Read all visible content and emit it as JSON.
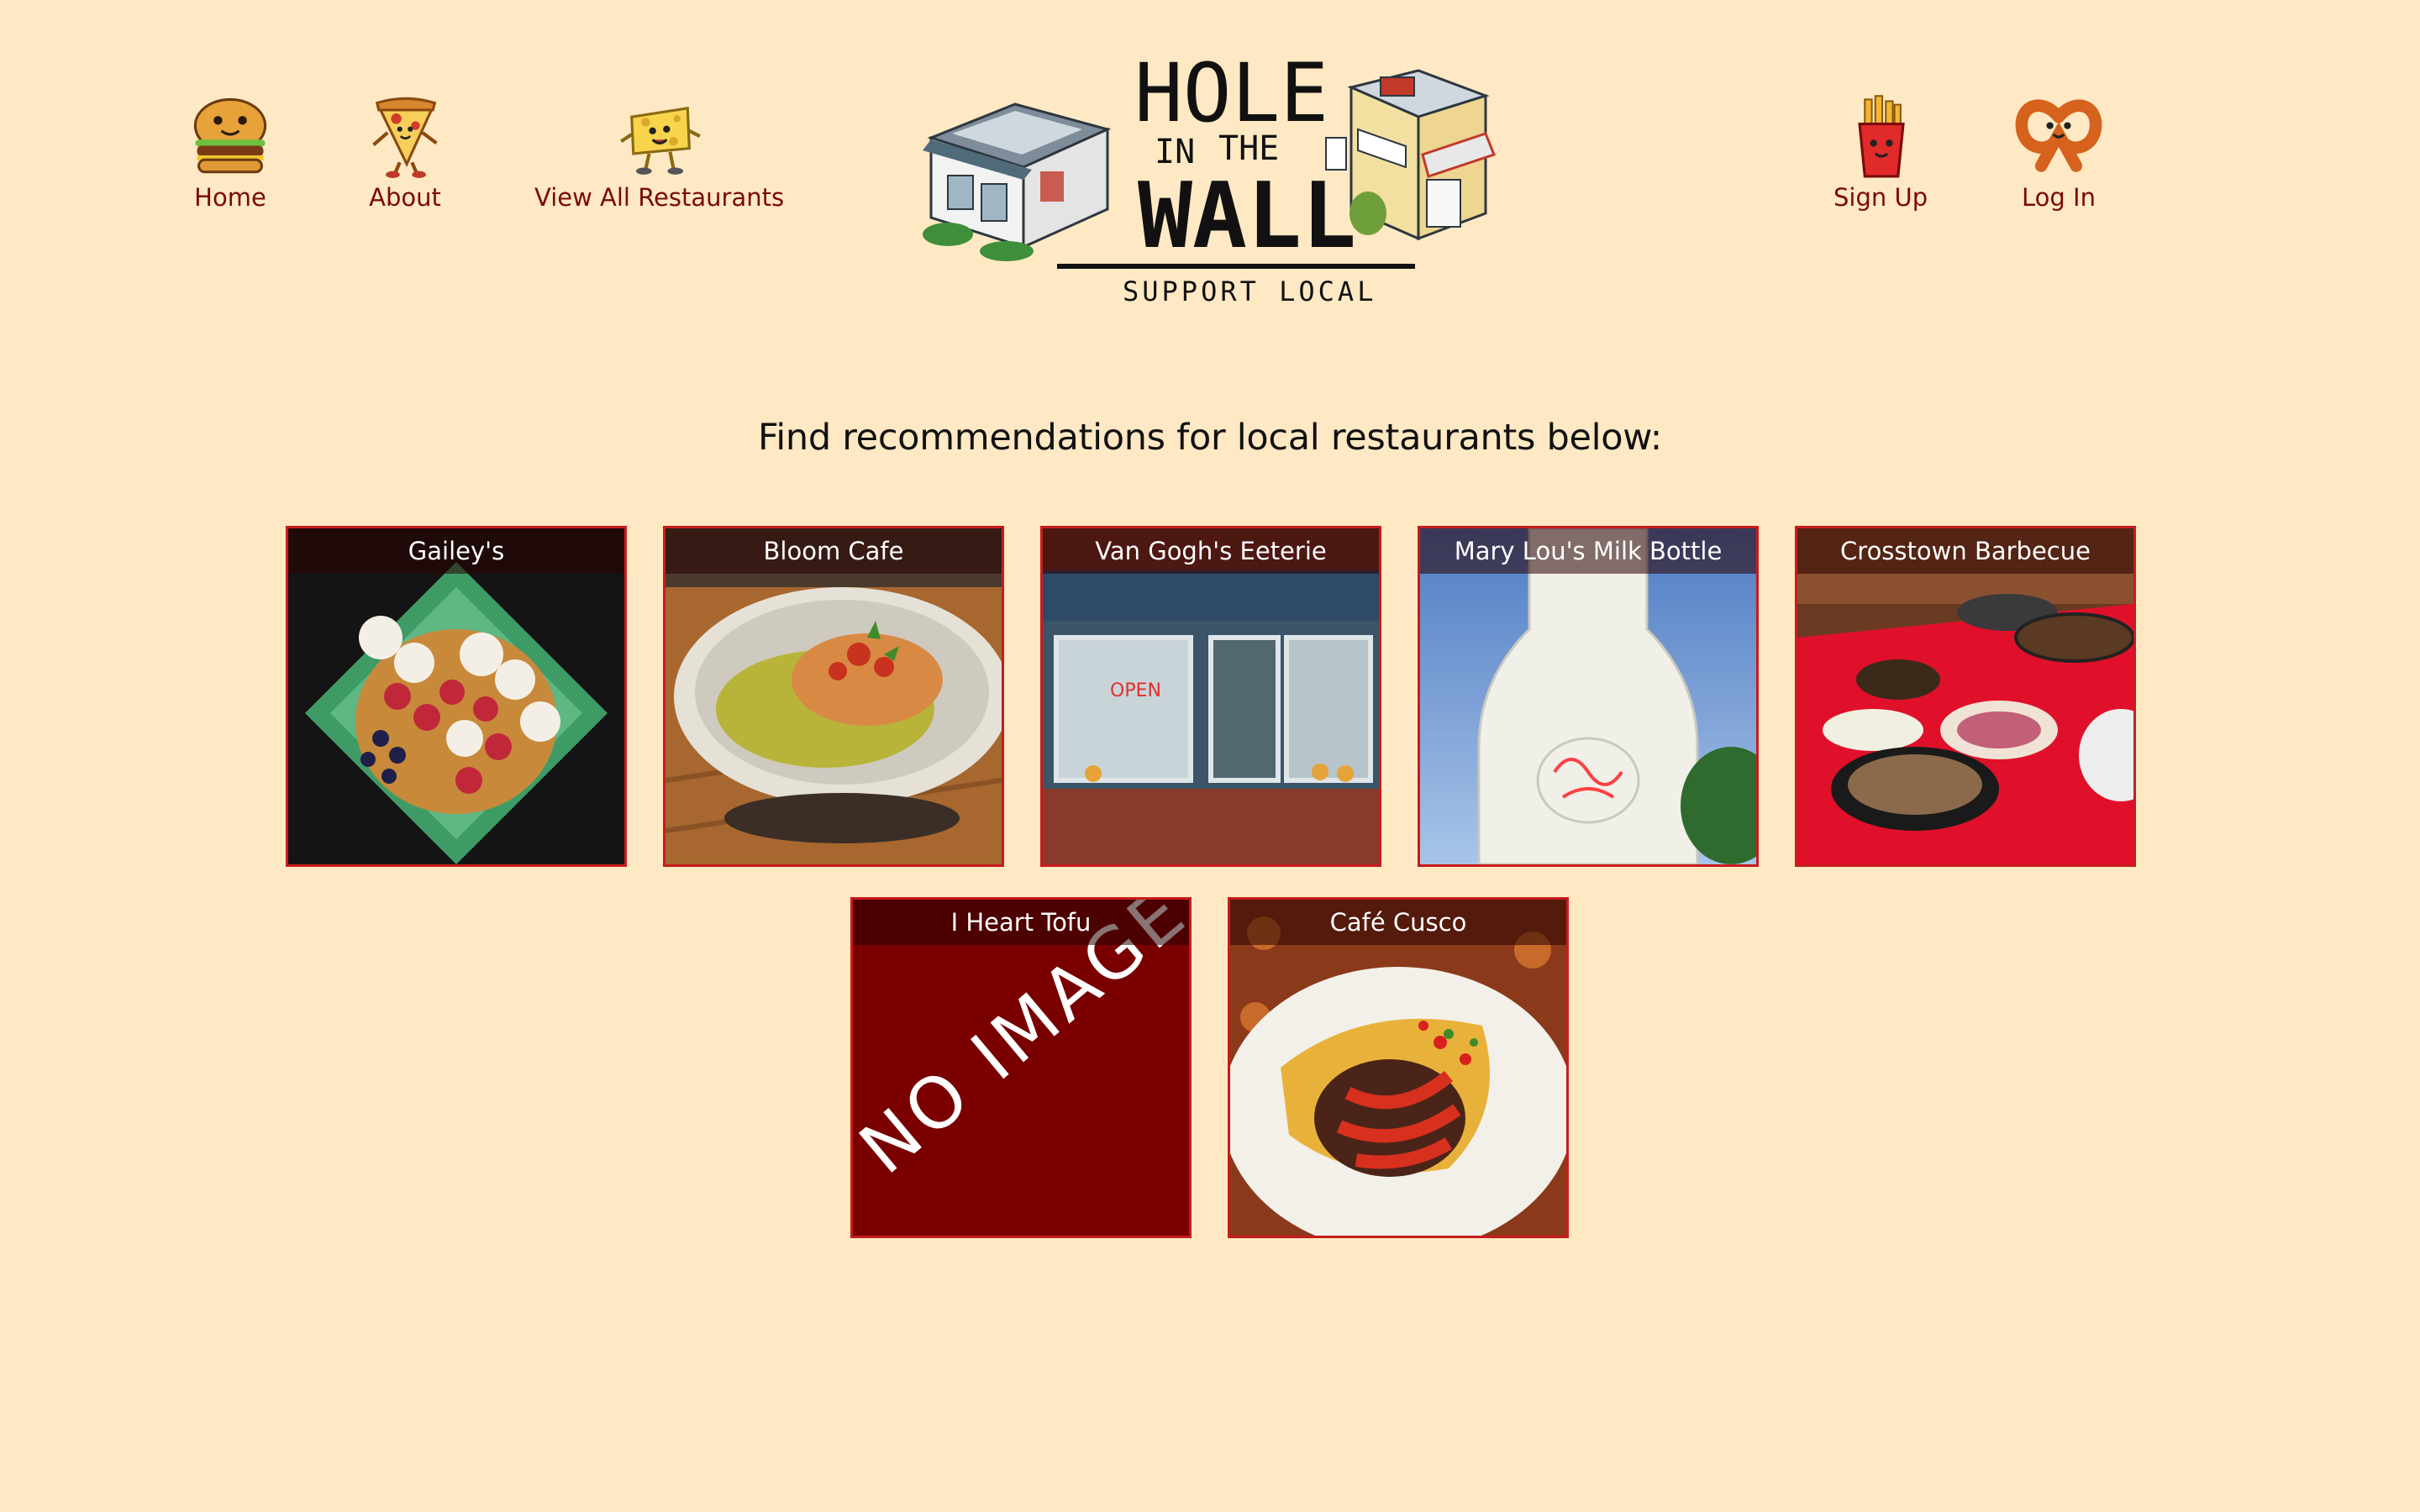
{
  "nav": {
    "left": [
      {
        "label": "Home"
      },
      {
        "label": "About"
      },
      {
        "label": "View All Restaurants"
      }
    ],
    "right": [
      {
        "label": "Sign Up"
      },
      {
        "label": "Log In"
      }
    ]
  },
  "logo": {
    "line1": "HOLE",
    "line2a": "IN",
    "line2b": "THE",
    "line3": "WALL",
    "tagline": "SUPPORT LOCAL"
  },
  "main": {
    "heading": "Find recommendations for local restaurants below:",
    "restaurants": [
      {
        "name": "Gailey's",
        "image": "dessert-photo"
      },
      {
        "name": "Bloom Cafe",
        "image": "bowl-photo"
      },
      {
        "name": "Van Gogh's Eeterie",
        "image": "storefront-photo"
      },
      {
        "name": "Mary Lou's Milk Bottle",
        "image": "milk-bottle-photo"
      },
      {
        "name": "Crosstown Barbecue",
        "image": "buffet-photo"
      },
      {
        "name": "I Heart Tofu",
        "image": "no-image-placeholder",
        "placeholder_text": "NO IMAGE"
      },
      {
        "name": "Café Cusco",
        "image": "plated-dish-photo"
      }
    ]
  },
  "colors": {
    "background": "#ffe9c4",
    "nav_text": "#7a0a0a",
    "card_border": "#c81c1c",
    "placeholder_bg": "#7a0000"
  }
}
